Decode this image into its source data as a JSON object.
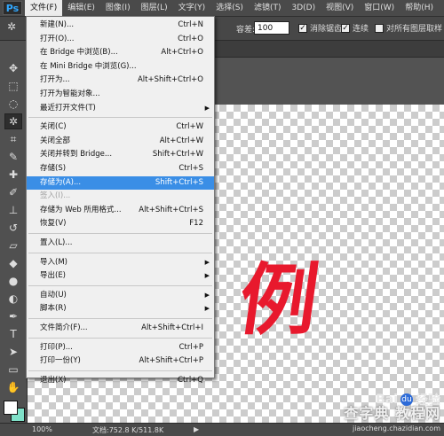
{
  "app": {
    "logo": "Ps"
  },
  "menubar": {
    "items": [
      {
        "label": "文件(F)",
        "active": true
      },
      {
        "label": "编辑(E)"
      },
      {
        "label": "图像(I)"
      },
      {
        "label": "图层(L)"
      },
      {
        "label": "文字(Y)"
      },
      {
        "label": "选择(S)"
      },
      {
        "label": "滤镜(T)"
      },
      {
        "label": "3D(D)"
      },
      {
        "label": "视图(V)"
      },
      {
        "label": "窗口(W)"
      },
      {
        "label": "帮助(H)"
      }
    ]
  },
  "options": {
    "tolerance_label": "容差:",
    "tolerance_value": "100",
    "antialias_label": "消除锯齿",
    "antialias_checked": true,
    "contiguous_label": "连续",
    "contiguous_checked": true,
    "all_layers_label": "对所有图层取样",
    "all_layers_checked": false
  },
  "file_menu": [
    {
      "label": "新建(N)...",
      "shortcut": "Ctrl+N"
    },
    {
      "label": "打开(O)...",
      "shortcut": "Ctrl+O"
    },
    {
      "label": "在 Bridge 中浏览(B)...",
      "shortcut": "Alt+Ctrl+O"
    },
    {
      "label": "在 Mini Bridge 中浏览(G)...",
      "shortcut": ""
    },
    {
      "label": "打开为...",
      "shortcut": "Alt+Shift+Ctrl+O"
    },
    {
      "label": "打开为智能对象...",
      "shortcut": ""
    },
    {
      "label": "最近打开文件(T)",
      "shortcut": "",
      "submenu": true
    },
    {
      "separator": true
    },
    {
      "label": "关闭(C)",
      "shortcut": "Ctrl+W"
    },
    {
      "label": "关闭全部",
      "shortcut": "Alt+Ctrl+W"
    },
    {
      "label": "关闭并转到 Bridge...",
      "shortcut": "Shift+Ctrl+W"
    },
    {
      "label": "存储(S)",
      "shortcut": "Ctrl+S"
    },
    {
      "label": "存储为(A)...",
      "shortcut": "Shift+Ctrl+S",
      "highlighted": true
    },
    {
      "label": "签入(I)...",
      "shortcut": "",
      "disabled": true
    },
    {
      "label": "存储为 Web 所用格式...",
      "shortcut": "Alt+Shift+Ctrl+S"
    },
    {
      "label": "恢复(V)",
      "shortcut": "F12"
    },
    {
      "separator": true
    },
    {
      "label": "置入(L)...",
      "shortcut": ""
    },
    {
      "separator": true
    },
    {
      "label": "导入(M)",
      "shortcut": "",
      "submenu": true
    },
    {
      "label": "导出(E)",
      "shortcut": "",
      "submenu": true
    },
    {
      "separator": true
    },
    {
      "label": "自动(U)",
      "shortcut": "",
      "submenu": true
    },
    {
      "label": "脚本(R)",
      "shortcut": "",
      "submenu": true
    },
    {
      "separator": true
    },
    {
      "label": "文件简介(F)...",
      "shortcut": "Alt+Shift+Ctrl+I"
    },
    {
      "separator": true
    },
    {
      "label": "打印(P)...",
      "shortcut": "Ctrl+P"
    },
    {
      "label": "打印一份(Y)",
      "shortcut": "Alt+Shift+Ctrl+P"
    },
    {
      "separator": true
    },
    {
      "label": "退出(X)",
      "shortcut": "Ctrl+Q"
    }
  ],
  "canvas": {
    "text": "例",
    "text_color": "#e8192d"
  },
  "status": {
    "zoom": "100%",
    "doc_info": "文档:752.8 K/511.8K",
    "arrow": "▶"
  },
  "watermark": {
    "baidu": "Bai",
    "paw": "du",
    "jingyan": "经验",
    "site": "查字典 教程网",
    "url": "jiaocheng.chazidian.com"
  },
  "colors": {
    "accent_highlight": "#3a8ee6",
    "menu_bg": "#f0f0f0",
    "ps_blue": "#31a8ff"
  }
}
